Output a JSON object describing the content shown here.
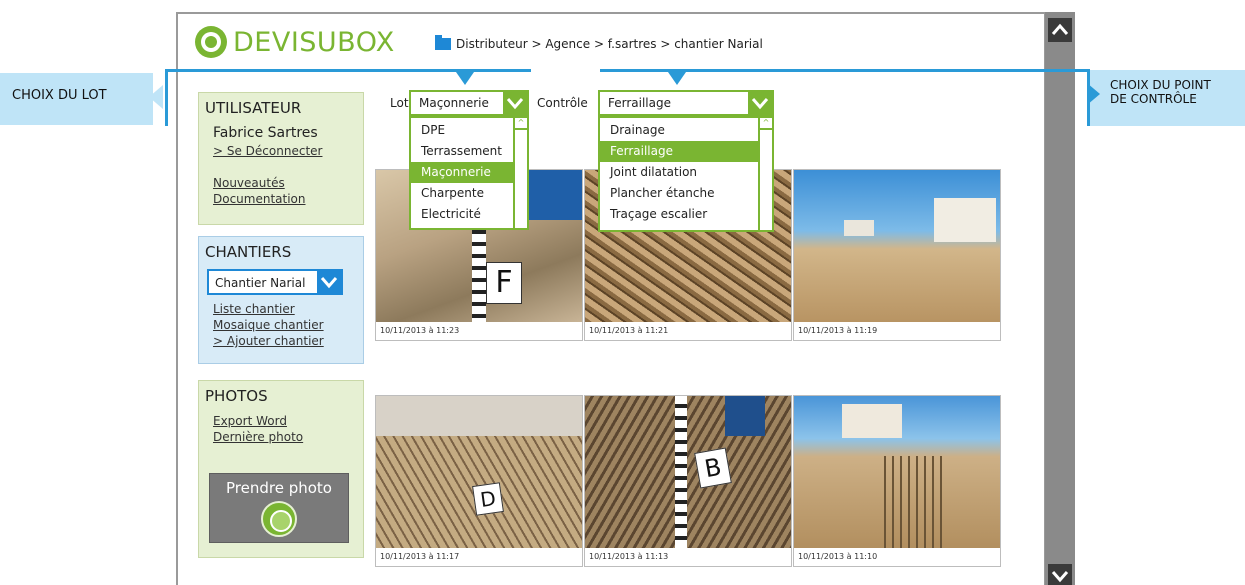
{
  "app": {
    "logo_text": "DEVISUBOX"
  },
  "breadcrumb": [
    "Distributeur",
    "Agence",
    "f.sartres",
    "chantier Narial"
  ],
  "breadcrumb_text": "Distributeur > Agence > f.sartres > chantier Narial",
  "annotations": {
    "lot": "CHOIX DU LOT",
    "point_line1": "CHOIX DU POINT",
    "point_line2": "DE CONTRÔLE"
  },
  "user_panel": {
    "title": "UTILISATEUR",
    "name": "Fabrice Sartres",
    "logout": "> Se Déconnecter",
    "news": "Nouveautés",
    "docs": "Documentation"
  },
  "chantiers_panel": {
    "title": "CHANTIERS",
    "selected": "Chantier Narial",
    "list": "Liste chantier",
    "mosaic": "Mosaique chantier",
    "add": "> Ajouter chantier"
  },
  "photos_panel": {
    "title": "PHOTOS",
    "export": "Export Word",
    "last": "Dernière photo",
    "take": "Prendre photo"
  },
  "filters": {
    "lot_label": "Lot",
    "lot_value": "Maçonnerie",
    "lot_options": [
      "DPE",
      "Terrassement",
      "Maçonnerie",
      "Charpente",
      "Electricité"
    ],
    "lot_selected_index": 2,
    "controle_label": "Contrôle",
    "controle_value": "Ferraillage",
    "controle_options": [
      "Drainage",
      "Ferraillage",
      "Joint dilatation",
      "Plancher étanche",
      "Traçage escalier"
    ],
    "controle_selected_index": 1
  },
  "photos": [
    {
      "caption": "10/11/2013 à 11:23",
      "sign": "F"
    },
    {
      "caption": "10/11/2013 à 11:21",
      "sign": ""
    },
    {
      "caption": "10/11/2013 à 11:19",
      "sign": ""
    },
    {
      "caption": "10/11/2013 à 11:17",
      "sign": "D"
    },
    {
      "caption": "10/11/2013 à 11:13",
      "sign": "B"
    },
    {
      "caption": "10/11/2013 à 11:10",
      "sign": ""
    }
  ],
  "colors": {
    "green": "#7ab532",
    "blue": "#1e88d6",
    "callout": "#bfe4f7"
  }
}
